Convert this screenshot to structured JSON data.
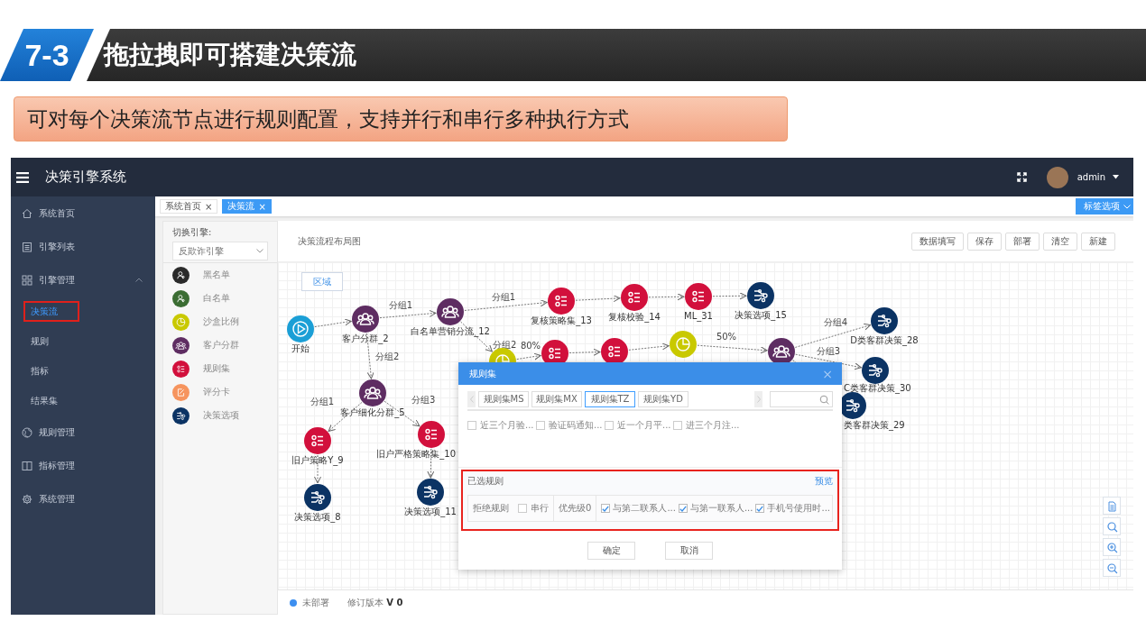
{
  "slide": {
    "number": "7-3",
    "title": "拖拉拽即可搭建决策流",
    "subtitle": "可对每个决策流节点进行规则配置，支持并行和串行多种执行方式"
  },
  "app": {
    "title": "决策引擎系统",
    "user": "admin"
  },
  "sidebar": {
    "items": [
      {
        "label": "系统首页"
      },
      {
        "label": "引擎列表"
      },
      {
        "label": "引擎管理",
        "expanded": true,
        "children": [
          {
            "label": "决策流",
            "selected": true,
            "highlighted": true
          },
          {
            "label": "规则",
            "selected": false,
            "highlighted": false
          },
          {
            "label": "指标",
            "selected": false,
            "highlighted": false
          },
          {
            "label": "结果集",
            "selected": false,
            "highlighted": false
          }
        ]
      },
      {
        "label": "规则管理"
      },
      {
        "label": "指标管理"
      },
      {
        "label": "系统管理"
      }
    ]
  },
  "tabs": [
    {
      "label": "系统首页",
      "close": "×",
      "selected": false
    },
    {
      "label": "决策流",
      "close": "×",
      "selected": true
    }
  ],
  "tab_options": "标签选项",
  "engine_panel": {
    "label": "切换引擎:",
    "select": "反欺诈引擎",
    "palette": [
      {
        "label": "黑名单",
        "kind": "blacklist"
      },
      {
        "label": "白名单",
        "kind": "whitelist"
      },
      {
        "label": "沙盒比例",
        "kind": "sandbox"
      },
      {
        "label": "客户分群",
        "kind": "group"
      },
      {
        "label": "规则集",
        "kind": "ruleset"
      },
      {
        "label": "评分卡",
        "kind": "scorecard"
      },
      {
        "label": "决策选项",
        "kind": "decision"
      }
    ]
  },
  "flow": {
    "title": "决策流程布局图",
    "buttons": [
      "数据填写",
      "保存",
      "部署",
      "清空",
      "新建"
    ],
    "area_button": "区域",
    "nodes": [
      {
        "label": "开始",
        "kind": "start"
      },
      {
        "label": "客户分群_2",
        "kind": "group"
      },
      {
        "label": "白名单营销分流_12",
        "kind": "group"
      },
      {
        "label": "复核策略集_13",
        "kind": "ruleset"
      },
      {
        "label": "复核校验_14",
        "kind": "ruleset"
      },
      {
        "label": "ML_31",
        "kind": "ruleset"
      },
      {
        "label": "决策选项_15",
        "kind": "decision"
      },
      {
        "kind": "sandbox"
      },
      {
        "kind": "ruleset"
      },
      {
        "kind": "ruleset"
      },
      {
        "kind": "sandbox"
      },
      {
        "kind": "group"
      },
      {
        "label": "D类客群决策_28",
        "kind": "decision"
      },
      {
        "label": "C类客群决策_30",
        "kind": "decision"
      },
      {
        "label": "类客群决策_29",
        "kind": "decision"
      },
      {
        "label": "客户细化分群_5",
        "kind": "group"
      },
      {
        "label": "旧户策略Y_9",
        "kind": "ruleset"
      },
      {
        "label": "旧户严格策略集_10",
        "kind": "ruleset"
      },
      {
        "label": "决策选项_8",
        "kind": "decision"
      },
      {
        "label": "决策选项_11",
        "kind": "decision"
      }
    ],
    "edge_labels": [
      "分组1",
      "分组1",
      "分组2",
      "80%",
      "50%",
      "分组4",
      "分组3",
      "分组2",
      "分组1",
      "分组3"
    ],
    "status": {
      "state": "未部署",
      "version": "修订版本 **V 0**"
    }
  },
  "dialog": {
    "title": "规则集",
    "close": "×",
    "tabs": [
      {
        "label": "规则集MS",
        "selected": false
      },
      {
        "label": "规则集MX",
        "selected": false
      },
      {
        "label": "规则集TZ",
        "selected": true
      },
      {
        "label": "规则集YD",
        "selected": false
      }
    ],
    "rules": [
      {
        "label": "近三个月验...",
        "checked": false
      },
      {
        "label": "验证码通知...",
        "checked": false
      },
      {
        "label": "近一个月平...",
        "checked": false
      },
      {
        "label": "进三个月注...",
        "checked": false
      }
    ],
    "selected_rules": {
      "title": "已选规则",
      "preview": "预览",
      "highlighted": true,
      "group": "拒绝规则",
      "serial": {
        "label": "串行",
        "checked": false
      },
      "priority": "优先级0",
      "items": [
        {
          "label": "与第二联系人...",
          "checked": true
        },
        {
          "label": "与第一联系人...",
          "checked": true
        },
        {
          "label": "手机号使用时...",
          "checked": true
        }
      ]
    },
    "buttons": [
      "确定",
      "取消"
    ]
  }
}
